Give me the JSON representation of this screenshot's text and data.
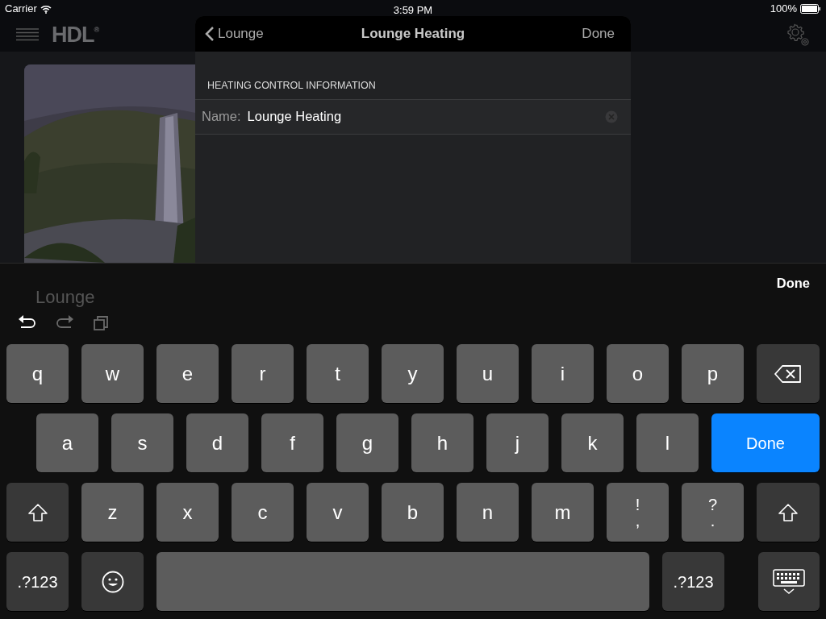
{
  "status_bar": {
    "carrier": "Carrier",
    "time": "3:59 PM",
    "battery": "100%"
  },
  "app_header": {
    "logo": "HDL$^{®}$"
  },
  "background": {
    "room_label": "Lounge"
  },
  "modal": {
    "back_label": "Lounge",
    "title": "Lounge Heating",
    "done": "Done",
    "section_header": "HEATING CONTROL INFORMATION",
    "fields": [
      {
        "label": "Name:",
        "value": "Lounge Heating"
      }
    ]
  },
  "keyboard": {
    "done": "Done",
    "toolbar": [
      {
        "kind": "undo",
        "disabled": false
      },
      {
        "kind": "redo",
        "disabled": true
      },
      {
        "kind": "paste",
        "disabled": true
      }
    ],
    "rows": [
      [
        {
          "kind": "letter",
          "label": "q"
        },
        {
          "kind": "letter",
          "label": "w"
        },
        {
          "kind": "letter",
          "label": "e"
        },
        {
          "kind": "letter",
          "label": "r"
        },
        {
          "kind": "letter",
          "label": "t"
        },
        {
          "kind": "letter",
          "label": "y"
        },
        {
          "kind": "letter",
          "label": "u"
        },
        {
          "kind": "letter",
          "label": "i"
        },
        {
          "kind": "letter",
          "label": "o"
        },
        {
          "kind": "letter",
          "label": "p"
        },
        {
          "kind": "backspace"
        }
      ],
      [
        {
          "kind": "letter",
          "label": "a"
        },
        {
          "kind": "letter",
          "label": "s"
        },
        {
          "kind": "letter",
          "label": "d"
        },
        {
          "kind": "letter",
          "label": "f"
        },
        {
          "kind": "letter",
          "label": "g"
        },
        {
          "kind": "letter",
          "label": "h"
        },
        {
          "kind": "letter",
          "label": "j"
        },
        {
          "kind": "letter",
          "label": "k"
        },
        {
          "kind": "letter",
          "label": "l"
        },
        {
          "kind": "return",
          "label": "Done"
        }
      ],
      [
        {
          "kind": "shift"
        },
        {
          "kind": "letter",
          "label": "z"
        },
        {
          "kind": "letter",
          "label": "x"
        },
        {
          "kind": "letter",
          "label": "c"
        },
        {
          "kind": "letter",
          "label": "v"
        },
        {
          "kind": "letter",
          "label": "b"
        },
        {
          "kind": "letter",
          "label": "n"
        },
        {
          "kind": "letter",
          "label": "m"
        },
        {
          "kind": "punct",
          "label": "!",
          "lower": ","
        },
        {
          "kind": "punct",
          "label": "?",
          "lower": "."
        },
        {
          "kind": "shift"
        }
      ],
      [
        {
          "kind": "symbols",
          "label": ".?123"
        },
        {
          "kind": "emoji"
        },
        {
          "kind": "space"
        },
        {
          "kind": "symbols",
          "label": ".?123"
        },
        {
          "kind": "dismiss"
        }
      ]
    ]
  }
}
